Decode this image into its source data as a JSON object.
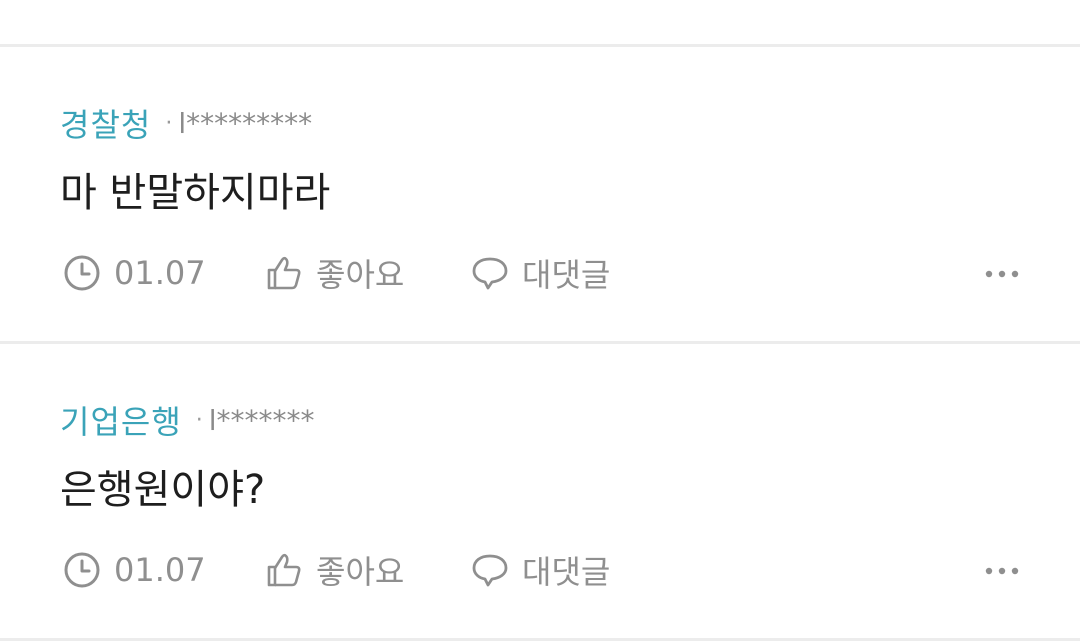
{
  "comments": [
    {
      "author": "경찰청",
      "separator": "·",
      "masked_id": "l*********",
      "text": "마 반말하지마라",
      "date": "01.07",
      "like_label": "좋아요",
      "reply_label": "대댓글",
      "time_icon": "clock-icon",
      "like_icon": "thumbs-up-icon",
      "reply_icon": "speech-bubble-icon",
      "more_icon": "more-dots-icon"
    },
    {
      "author": "기업은행",
      "separator": "·",
      "masked_id": "l*******",
      "text": "은행원이야?",
      "date": "01.07",
      "like_label": "좋아요",
      "reply_label": "대댓글",
      "time_icon": "clock-icon",
      "like_icon": "thumbs-up-icon",
      "reply_icon": "speech-bubble-icon",
      "more_icon": "more-dots-icon"
    }
  ],
  "colors": {
    "author": "#3aa3b8",
    "text": "#1e1e1e",
    "muted": "#8f8f8f",
    "divider": "#ececec"
  }
}
